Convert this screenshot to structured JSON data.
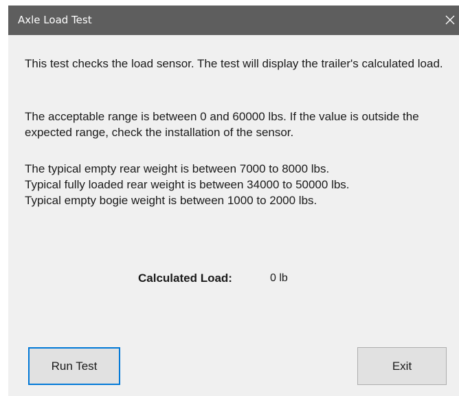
{
  "window": {
    "title": "Axle Load Test",
    "close_icon": "close-icon"
  },
  "description": {
    "paragraph1": "This test checks the load sensor. The test will display the trailer's calculated load.",
    "paragraph2": "The acceptable range is between 0 and 60000 lbs. If the value is outside the expected range, check the installation of the sensor.",
    "line3": "The typical empty rear weight is between 7000 to 8000 lbs.",
    "line4": "Typical fully loaded rear weight is between 34000 to 50000 lbs.",
    "line5": "Typical empty bogie weight is between 1000 to 2000 lbs."
  },
  "result": {
    "label": "Calculated Load:",
    "value": "0 lb"
  },
  "buttons": {
    "run_label": "Run Test",
    "exit_label": "Exit"
  },
  "colors": {
    "titlebar": "#5e5e5e",
    "client_background": "#f0f0f0",
    "focus_border": "#0078d7",
    "button_face": "#e1e1e1"
  }
}
